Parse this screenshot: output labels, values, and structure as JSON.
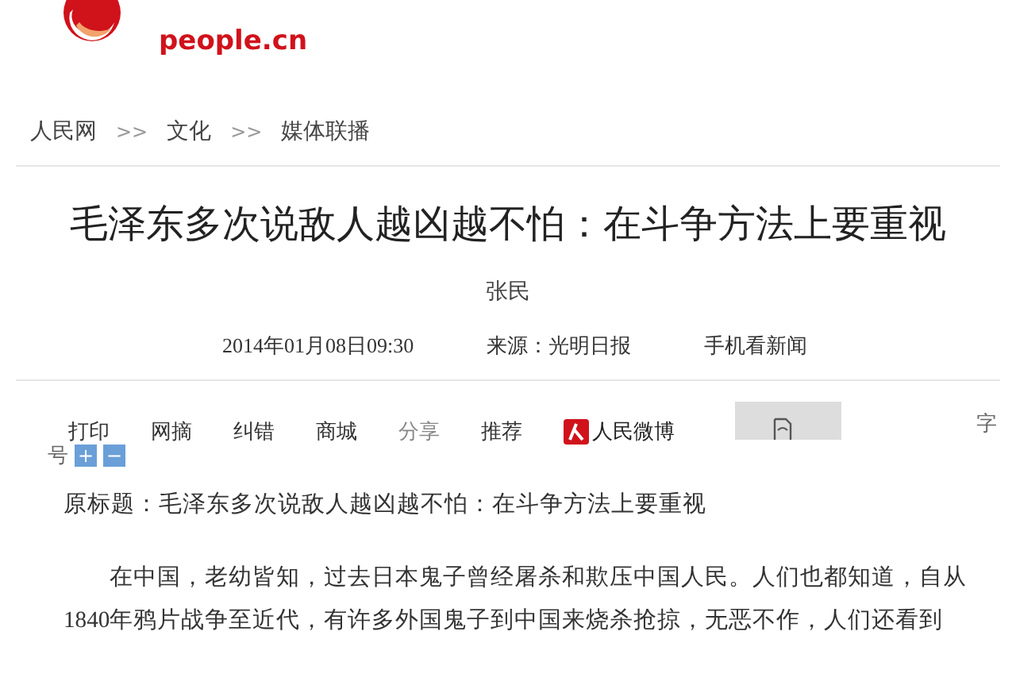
{
  "logo": {
    "text": "people.cn"
  },
  "breadcrumb": [
    {
      "label": "人民网"
    },
    {
      "label": "文化"
    },
    {
      "label": "媒体联播"
    }
  ],
  "breadcrumb_separator": ">>",
  "article": {
    "title": "毛泽东多次说敌人越凶越不怕：在斗争方法上要重视",
    "author": "张民",
    "date": "2014年01月08日09:30",
    "source": "来源：光明日报",
    "mobile_link": "手机看新闻"
  },
  "toolbar": [
    {
      "label": "打印",
      "disabled": false
    },
    {
      "label": "网摘",
      "disabled": false
    },
    {
      "label": "纠错",
      "disabled": false
    },
    {
      "label": "商城",
      "disabled": false
    },
    {
      "label": "分享",
      "disabled": true
    },
    {
      "label": "推荐",
      "disabled": false
    }
  ],
  "weibo": {
    "label": "人民微博"
  },
  "font_size": {
    "label_top": "字",
    "label_bottom": "号",
    "increase": "+",
    "decrease": "−"
  },
  "body": {
    "original_title": "原标题：毛泽东多次说敌人越凶越不怕：在斗争方法上要重视",
    "paragraphs": [
      "在中国，老幼皆知，过去日本鬼子曾经屠杀和欺压中国人民。人们也都知道，自从1840年鸦片战争至近代，有许多外国鬼子到中国来烧杀抢掠，无恶不作，人们还看到"
    ]
  }
}
